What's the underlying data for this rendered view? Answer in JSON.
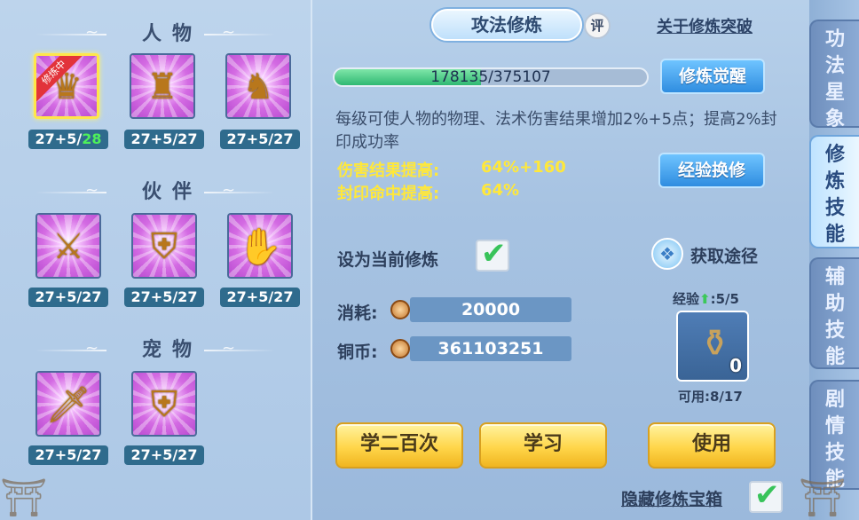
{
  "left": {
    "sections": [
      {
        "title": "人物",
        "slots": [
          {
            "badge": "修炼中",
            "level": "27+5/",
            "level_hi": "28",
            "selected": true,
            "figure": "person-armor-icon"
          },
          {
            "level": "27+5/27",
            "figure": "person-shield-icon"
          },
          {
            "level": "27+5/27",
            "figure": "person-sword-icon"
          }
        ]
      },
      {
        "title": "伙伴",
        "slots": [
          {
            "level": "27+5/27",
            "figure": "partner-sword-icon"
          },
          {
            "level": "27+5/27",
            "figure": "partner-shield-icon"
          },
          {
            "level": "27+5/27",
            "figure": "partner-glove-icon"
          }
        ]
      },
      {
        "title": "宠物",
        "slots": [
          {
            "level": "27+5/27",
            "figure": "pet-sword-icon"
          },
          {
            "level": "27+5/27",
            "figure": "pet-shield-icon"
          }
        ]
      }
    ]
  },
  "header": {
    "title": "攻法修炼",
    "rate_badge": "评",
    "link": "关于修炼突破"
  },
  "progress": {
    "text": "178135/375107",
    "current": 178135,
    "max": 375107
  },
  "buttons": {
    "awaken": "修炼觉醒",
    "exchange": "经验换修",
    "learn100": "学二百次",
    "learn": "学习",
    "use": "使用"
  },
  "desc": "每级可使人物的物理、法术伤害结果增加2%+5点；提高2%封印成功率",
  "stats": [
    {
      "label": "伤害结果提高:",
      "value": "64%+160"
    },
    {
      "label": "封印命中提高:",
      "value": "64%"
    }
  ],
  "set_current_label": "设为当前修炼",
  "get_path": "获取途径",
  "cost": {
    "label": "消耗:",
    "value": "20000"
  },
  "copper": {
    "label": "铜币:",
    "value": "361103251"
  },
  "exp": {
    "label": "经验",
    "value": ":5/5",
    "available": "可用:8/17",
    "count": "0"
  },
  "hide_chest": "隐藏修炼宝箱",
  "tabs": [
    "功法星象",
    "修炼技能",
    "辅助技能",
    "剧情技能"
  ],
  "colors": {
    "stat_yellow": "#ffe83a",
    "accent_blue": "#2f8de0",
    "gold": "#ffd64a",
    "check_green": "#38c35a"
  }
}
